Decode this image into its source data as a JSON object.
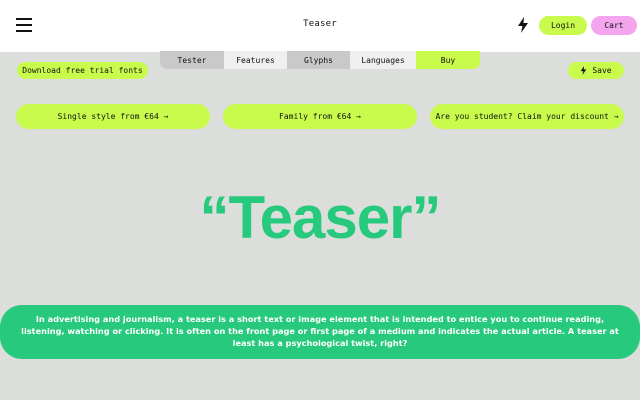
{
  "header": {
    "title": "Teaser",
    "login_label": "Login",
    "cart_label": "Cart",
    "menu_icon": "hamburger-menu-icon",
    "theme_icon": "lightning-bolt-icon"
  },
  "tabs": [
    {
      "label": "Tester"
    },
    {
      "label": "Features"
    },
    {
      "label": "Glyphs"
    },
    {
      "label": "Languages"
    },
    {
      "label": "Buy"
    }
  ],
  "actions": {
    "download_label": "Download free trial fonts",
    "save_label": "Save",
    "save_icon": "lightning-bolt-icon"
  },
  "pricing": [
    {
      "label": "Single style from €64 →"
    },
    {
      "label": "Family from €64 →"
    },
    {
      "label": "Are you student? Claim your discount →"
    }
  ],
  "specimen": {
    "headline": "“Teaser”",
    "description": "In advertising and journalism, a teaser is a short text or image element that is intended to entice you to continue reading, listening, watching or clicking. It is often on the front page or first page of a medium and indicates the actual article. A teaser at least has a psychological twist, right?"
  },
  "colors": {
    "accent_lime": "#c9fb4c",
    "accent_pink": "#f3a6ee",
    "accent_green": "#27c97c",
    "background": "#dcdedb"
  }
}
